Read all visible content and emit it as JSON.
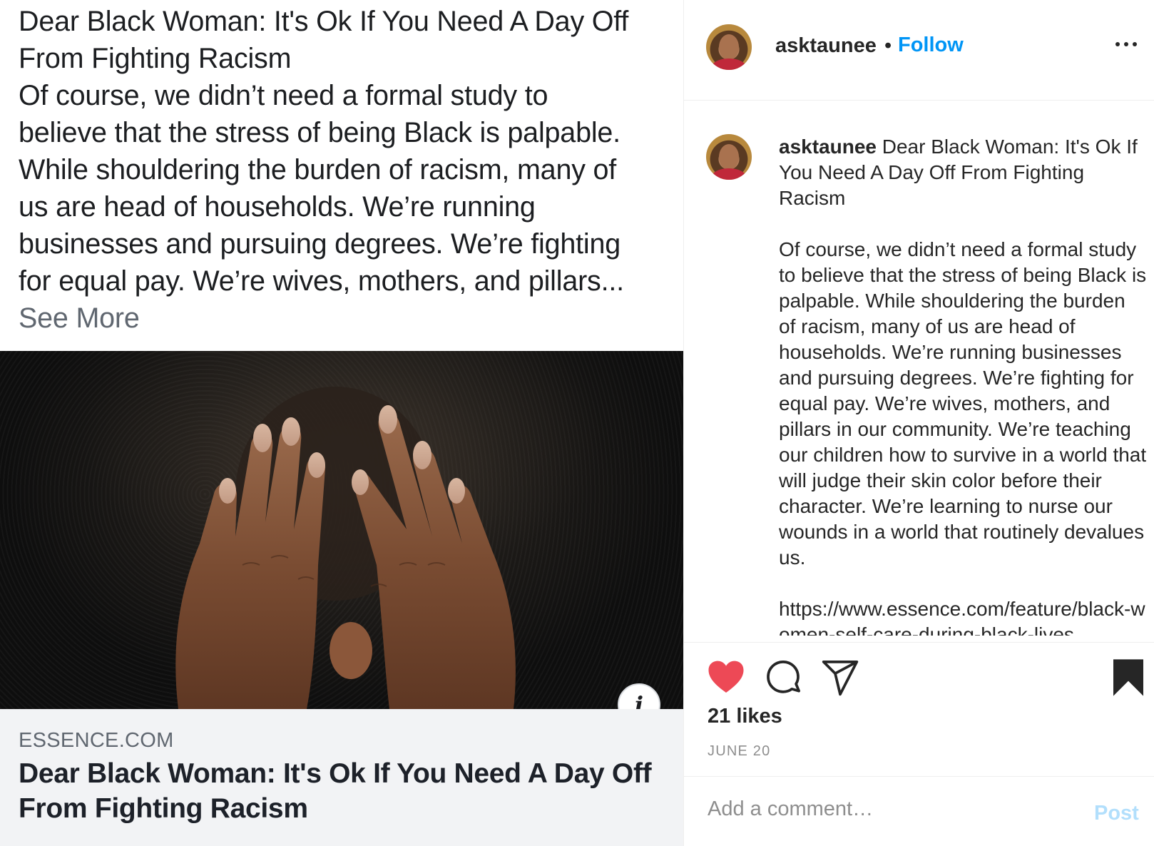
{
  "shared_post": {
    "text_lines": [
      "Dear Black Woman: It's Ok If You Need A Day Off",
      "From Fighting Racism",
      "Of course, we didn’t need a formal study to",
      "believe that the stress of being Black is palpable.",
      "While shouldering the burden of racism, many of",
      "us are head of households. We’re running",
      "businesses and pursuing degrees. We’re fighting",
      "for equal pay. We’re wives, mothers, and pillars..."
    ],
    "see_more": "See More",
    "info_icon": "i",
    "link_card": {
      "domain": "ESSENCE.COM",
      "title_lines": [
        "Dear Black Woman: It's Ok If You Need A Day Off",
        "From Fighting Racism"
      ]
    }
  },
  "header": {
    "username": "asktaunee",
    "separator": "•",
    "follow_label": "Follow",
    "more_icon": "more-horizontal-icon"
  },
  "caption": {
    "username": "asktaunee",
    "title": "Dear Black Woman: It's Ok If You Need A Day Off From Fighting Racism",
    "body": "Of course, we didn’t need a formal study to believe that the stress of being Black is palpable. While shouldering the burden of racism, many of us are head of households. We’re running businesses and pursuing degrees. We’re fighting for equal pay. We’re wives, mothers, and pillars in our community. We’re teaching our children how to survive in a world that will judge their skin color before their character. We’re learning to nurse our wounds in a world that routinely devalues us.",
    "link": "https://www.essence.com/feature/black-women-self-care-during-black-lives"
  },
  "actions": {
    "like_icon": "heart-filled-icon",
    "comment_icon": "comment-icon",
    "share_icon": "paper-plane-icon",
    "save_icon": "bookmark-filled-icon",
    "like_color": "#ed4956"
  },
  "likes_label": "21 likes",
  "date_label": "JUNE 20",
  "comment": {
    "placeholder": "Add a comment…",
    "post_label": "Post"
  },
  "colors": {
    "follow": "#0095f6",
    "post_disabled": "#b2dffc",
    "link_card_bg": "#f2f3f5"
  }
}
